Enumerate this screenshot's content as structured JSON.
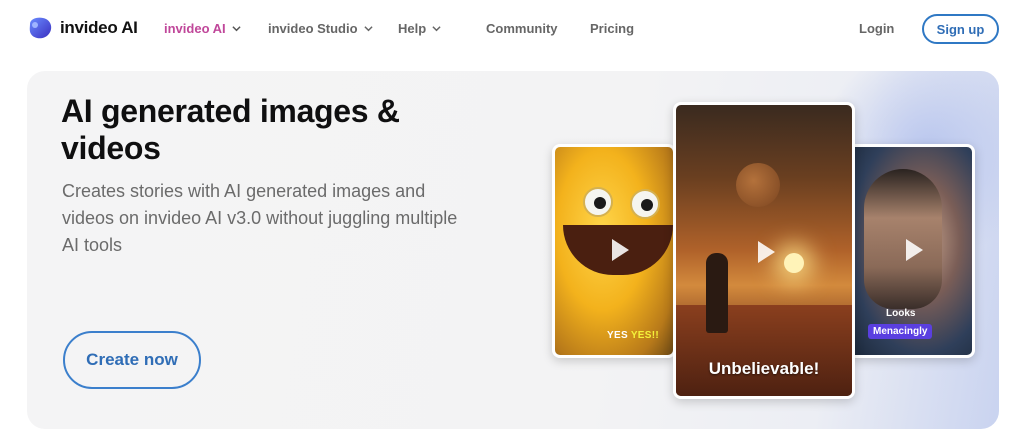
{
  "brand": {
    "name": "invideo AI"
  },
  "nav": {
    "items": [
      {
        "label": "invideo AI",
        "active": true,
        "has_dropdown": true
      },
      {
        "label": "invideo Studio",
        "active": false,
        "has_dropdown": true
      },
      {
        "label": "Help",
        "active": false,
        "has_dropdown": true
      },
      {
        "label": "Community",
        "active": false,
        "has_dropdown": false
      },
      {
        "label": "Pricing",
        "active": false,
        "has_dropdown": false
      }
    ],
    "login_label": "Login",
    "signup_label": "Sign up"
  },
  "hero": {
    "title": "AI generated images & videos",
    "subtitle": "Creates stories with AI generated images and videos on invideo AI v3.0 without juggling multiple AI tools",
    "cta_label": "Create now"
  },
  "cards": {
    "left": {
      "caption_plain": "YES",
      "caption_highlight": "YES!!"
    },
    "middle": {
      "caption": "Unbelievable!"
    },
    "right": {
      "caption_top": "Looks",
      "caption_badge": "Menacingly"
    }
  },
  "colors": {
    "accent_active": "#c0479a",
    "primary_blue": "#2f6db6",
    "badge_purple": "#5a3fe0",
    "highlight_yellow": "#f4f23a"
  },
  "icons": [
    "invideo-logo-icon",
    "chevron-down-icon",
    "play-icon"
  ]
}
